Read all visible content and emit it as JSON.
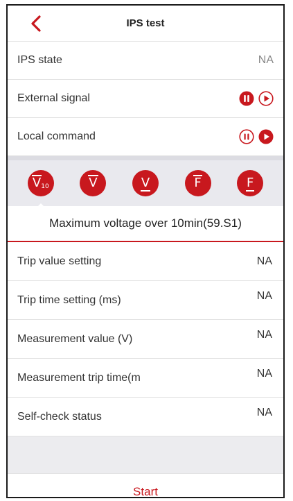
{
  "header": {
    "title": "IPS test",
    "back_icon": "chevron-left-icon"
  },
  "status_rows": [
    {
      "label": "IPS state",
      "value": "NA"
    },
    {
      "label": "External signal",
      "controls": [
        "pause-filled-icon",
        "play-outline-icon"
      ]
    },
    {
      "label": "Local command",
      "controls": [
        "pause-outline-icon",
        "play-filled-icon"
      ]
    }
  ],
  "modes": {
    "items": [
      {
        "symbol": "V",
        "subscript": "10",
        "mark": "overline",
        "icon": "v10-mode-icon"
      },
      {
        "symbol": "V",
        "mark": "overline",
        "icon": "v-over-mode-icon"
      },
      {
        "symbol": "V",
        "mark": "underline",
        "icon": "v-under-mode-icon"
      },
      {
        "symbol": "F",
        "mark": "overline",
        "icon": "f-over-mode-icon"
      },
      {
        "symbol": "F",
        "mark": "underline",
        "icon": "f-under-mode-icon"
      }
    ],
    "selected_index": 0
  },
  "description": "Maximum voltage over 10min(59.S1)",
  "detail_rows": [
    {
      "label": "Trip value setting",
      "value": "NA"
    },
    {
      "label": "Trip time setting (ms)",
      "value": "NA"
    },
    {
      "label": "Measurement value (V)",
      "value": "NA"
    },
    {
      "label": "Measurement trip time(m",
      "value": "NA"
    },
    {
      "label": "Self-check status",
      "value": "NA"
    }
  ],
  "footer": {
    "start_label": "Start"
  },
  "colors": {
    "accent": "#c8181e",
    "bar_bg": "#e9e9ee",
    "divider": "#e2e2e2"
  }
}
